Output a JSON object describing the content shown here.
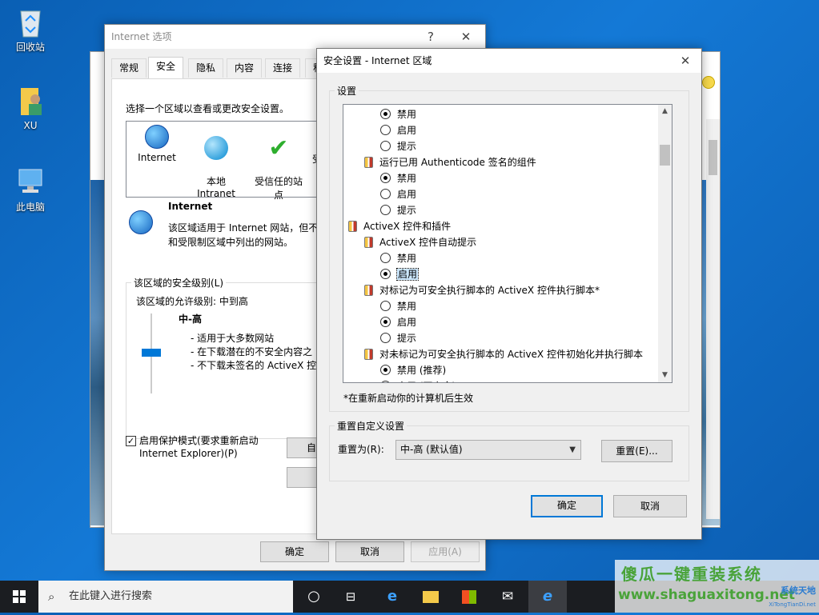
{
  "desktop": {
    "icons": [
      {
        "label": "回收站"
      },
      {
        "label": "XU"
      },
      {
        "label": "此电脑"
      }
    ]
  },
  "ie_options": {
    "title": "Internet 选项",
    "help": "?",
    "close": "✕",
    "tabs": [
      "常规",
      "安全",
      "隐私",
      "内容",
      "连接",
      "程"
    ],
    "zone_prompt": "选择一个区域以查看或更改安全设置。",
    "zones": [
      {
        "label": "Internet"
      },
      {
        "label": "本地\nIntranet"
      },
      {
        "label": "受信任的站\n点"
      },
      {
        "label": "受"
      }
    ],
    "zone_title": "Internet",
    "zone_desc_1": "该区域适用于 Internet 网站，但不",
    "zone_desc_2": "和受限制区域中列出的网站。",
    "security_level_legend": "该区域的安全级别(L)",
    "allowed_level": "该区域的允许级别: 中到高",
    "level_name": "中-高",
    "level_items": [
      "- 适用于大多数网站",
      "- 在下载潜在的不安全内容之",
      "- 不下载未签名的 ActiveX 控"
    ],
    "protected_mode_1": "启用保护模式(要求重新启动",
    "protected_mode_2": "Internet Explorer)(P)",
    "custom_btn": "自定义",
    "default_btn": "将",
    "ok": "确定",
    "cancel": "取消",
    "apply": "应用(A)"
  },
  "sec_settings": {
    "title": "安全设置 - Internet 区域",
    "close": "✕",
    "settings_legend": "设置",
    "tree": [
      {
        "kind": "radio",
        "indent": 1,
        "checked": true,
        "label": "禁用"
      },
      {
        "kind": "radio",
        "indent": 1,
        "checked": false,
        "label": "启用"
      },
      {
        "kind": "radio",
        "indent": 1,
        "checked": false,
        "label": "提示"
      },
      {
        "kind": "item",
        "indent": 0.5,
        "label": "运行已用 Authenticode 签名的组件"
      },
      {
        "kind": "radio",
        "indent": 1,
        "checked": true,
        "label": "禁用"
      },
      {
        "kind": "radio",
        "indent": 1,
        "checked": false,
        "label": "启用"
      },
      {
        "kind": "radio",
        "indent": 1,
        "checked": false,
        "label": "提示"
      },
      {
        "kind": "cat",
        "indent": 0,
        "label": "ActiveX 控件和插件"
      },
      {
        "kind": "item",
        "indent": 0.5,
        "label": "ActiveX 控件自动提示"
      },
      {
        "kind": "radio",
        "indent": 1,
        "checked": false,
        "label": "禁用"
      },
      {
        "kind": "radio",
        "indent": 1,
        "checked": true,
        "label": "启用",
        "selected": true
      },
      {
        "kind": "item",
        "indent": 0.5,
        "label": "对标记为可安全执行脚本的 ActiveX 控件执行脚本*"
      },
      {
        "kind": "radio",
        "indent": 1,
        "checked": false,
        "label": "禁用"
      },
      {
        "kind": "radio",
        "indent": 1,
        "checked": true,
        "label": "启用"
      },
      {
        "kind": "radio",
        "indent": 1,
        "checked": false,
        "label": "提示"
      },
      {
        "kind": "item",
        "indent": 0.5,
        "label": "对未标记为可安全执行脚本的 ActiveX 控件初始化并执行脚本"
      },
      {
        "kind": "radio",
        "indent": 1,
        "checked": true,
        "label": "禁用 (推荐)"
      },
      {
        "kind": "radio",
        "indent": 1,
        "checked": false,
        "label": "启用 (不安全)"
      }
    ],
    "restart_note": "*在重新启动你的计算机后生效",
    "reset_legend": "重置自定义设置",
    "reset_to_label": "重置为(R):",
    "reset_value": "中-高 (默认值)",
    "reset_btn": "重置(E)...",
    "ok": "确定",
    "cancel": "取消"
  },
  "taskbar": {
    "search_placeholder": "在此键入进行搜索"
  },
  "watermark": {
    "line1": "傻瓜一键重装系统",
    "line2": "www.shaguaxitong.net",
    "brand": "系统天地",
    "brand_url": "XiTongTianDi.net"
  }
}
